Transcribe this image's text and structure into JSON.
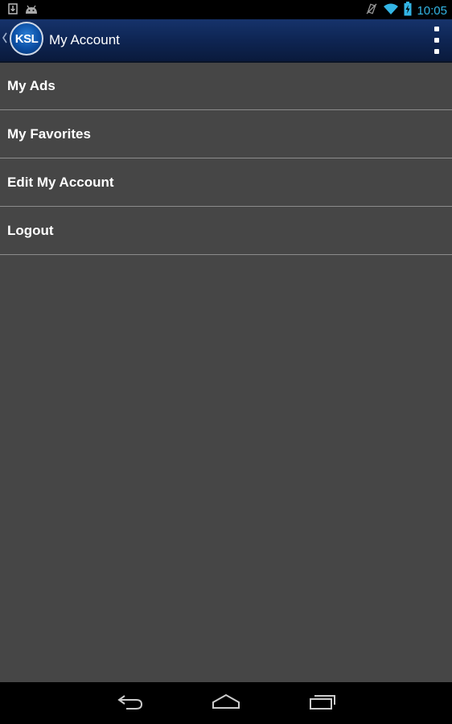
{
  "status_bar": {
    "time": "10:05",
    "icons": [
      "download-icon",
      "android-debug-icon",
      "vibrate-off-icon",
      "wifi-icon",
      "battery-charging-icon"
    ],
    "accent_color": "#33b5e5"
  },
  "action_bar": {
    "logo_text": "KSL",
    "title": "My Account",
    "overflow_icon": "overflow-menu-icon"
  },
  "menu": {
    "items": [
      {
        "label": "My Ads"
      },
      {
        "label": "My Favorites"
      },
      {
        "label": "Edit My Account"
      },
      {
        "label": "Logout"
      }
    ]
  },
  "nav_bar": {
    "buttons": [
      "back-icon",
      "home-icon",
      "recent-apps-icon"
    ]
  }
}
